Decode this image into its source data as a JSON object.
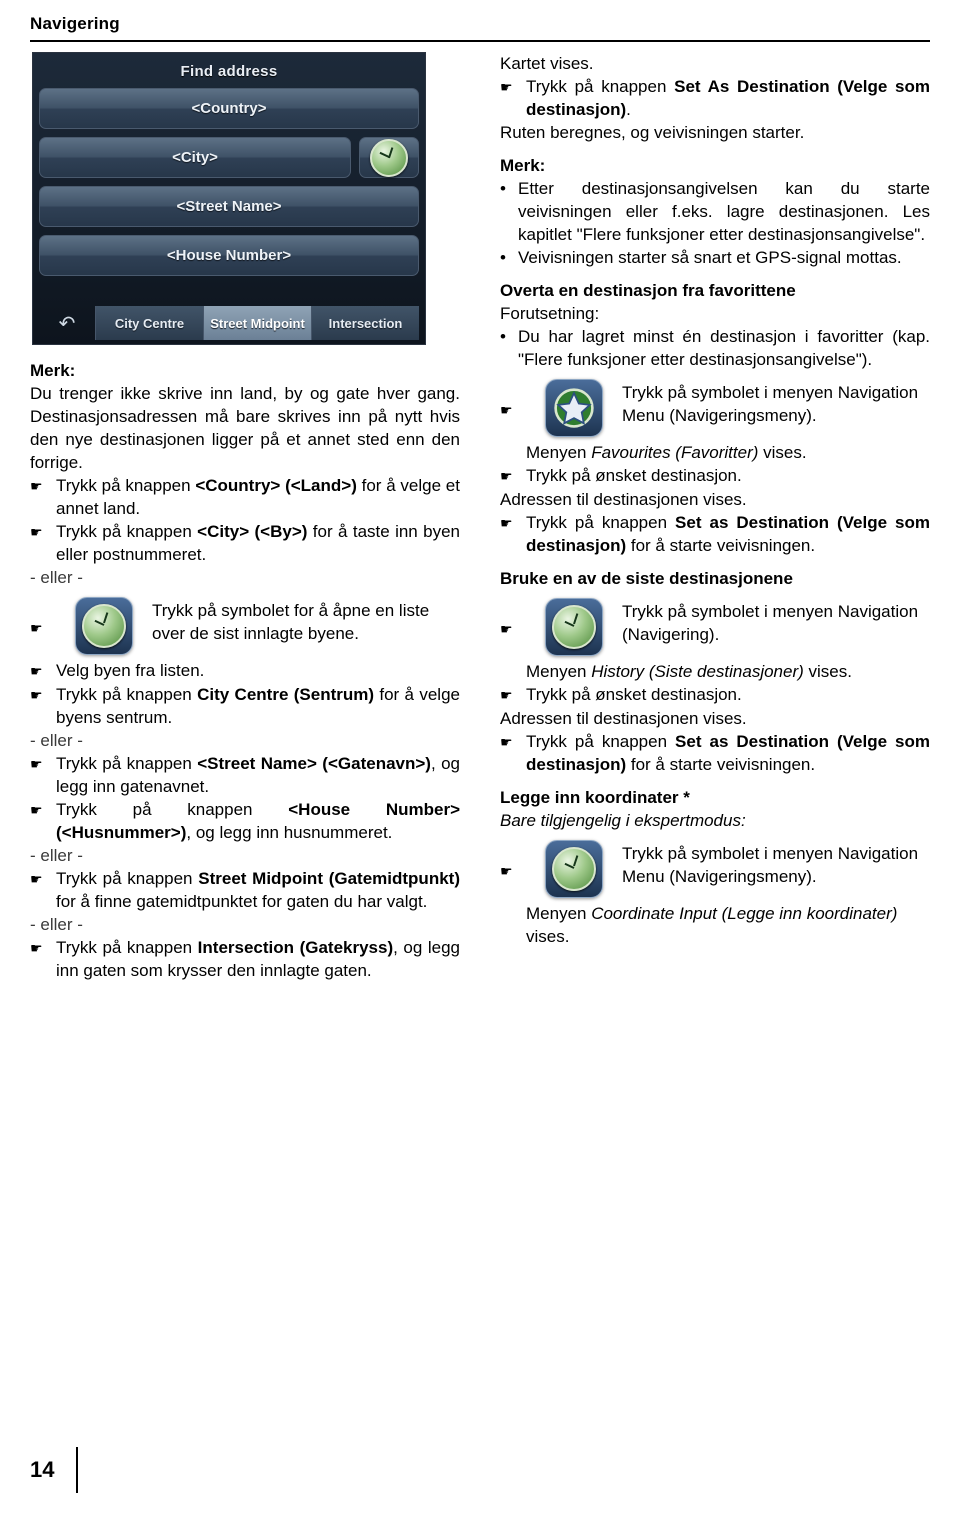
{
  "header": {
    "title": "Navigering"
  },
  "footer": {
    "page_number": "14"
  },
  "device": {
    "title": "Find address",
    "buttons": {
      "country": "<Country>",
      "city": "<City>",
      "street": "<Street Name>",
      "house": "<House Number>"
    },
    "compass_icon": "compass-icon",
    "back_icon": "back-arrow-icon",
    "tabs": [
      {
        "label": "City Centre",
        "active": false
      },
      {
        "label": "Street Midpoint",
        "active": true
      },
      {
        "label": "Intersection",
        "active": false
      }
    ]
  },
  "left": {
    "note_heading": "Merk:",
    "note_text": "Du trenger ikke skrive inn land, by og gate hver gang. Destinasjonsadressen må bare skrives inn på nytt hvis den nye destinasjonen ligger på et annet sted enn den forrige.",
    "step_country_a": "Trykk på knappen ",
    "step_country_b": "<Country> (<Land>)",
    "step_country_c": " for å velge et annet land.",
    "step_city_a": "Trykk på knappen ",
    "step_city_b": "<City> (<By>)",
    "step_city_c": " for å taste inn byen eller postnummeret.",
    "eller_1": "- eller -",
    "step_icon_city": "Trykk på symbolet for å åpne en liste over de sist innlagte byene.",
    "step_velg": "Velg byen fra listen.",
    "step_centre_a": "Trykk på knappen ",
    "step_centre_b": "City Centre (Sentrum)",
    "step_centre_c": " for å velge byens sentrum.",
    "eller_2": "- eller -",
    "step_street_a": "Trykk på knappen ",
    "step_street_b": "<Street Name> (<Gatenavn>)",
    "step_street_c": ", og legg inn gatenavnet.",
    "step_house_a": "Trykk på knappen ",
    "step_house_b": "<House Number> (<Husnummer>)",
    "step_house_c": ", og legg inn husnummeret.",
    "eller_3": "- eller -",
    "step_midpoint_a": "Trykk på knappen ",
    "step_midpoint_b": "Street Midpoint (Gatemidtpunkt)",
    "step_midpoint_c": " for å finne gatemidtpunktet for gaten du har valgt.",
    "eller_4": "- eller -",
    "step_inter_a": "Trykk på knappen ",
    "step_inter_b": "Intersection (Gatekryss)",
    "step_inter_c": ", og legg inn gaten som krysser den innlagte gaten."
  },
  "right": {
    "kartet": "Kartet vises.",
    "step_setdest_a": "Trykk på knappen ",
    "step_setdest_b": "Set As Destination (Velge som destinasjon)",
    "step_setdest_c": ".",
    "ruten": "Ruten beregnes, og veivisningen starter.",
    "merk_heading": "Merk:",
    "merk_b1": "Etter destinasjonsangivelsen kan du starte veivisningen eller f.eks. lagre destinasjonen. Les kapitlet \"Flere funksjoner etter destinasjonsangivelse\".",
    "merk_b2": "Veivisningen starter så snart et GPS-signal mottas.",
    "fav_heading": "Overta en destinasjon fra favorittene",
    "fav_forutsetning": "Forutsetning:",
    "fav_b1": "Du har lagret minst én destinasjon i favoritter (kap. \"Flere funksjoner etter destinasjonsangivelse\").",
    "fav_step_icon_a": "Trykk på symbolet i menyen Navigation Menu (Navigeringsmeny).",
    "fav_menu_a": "Menyen ",
    "fav_menu_b": "Favourites (Favoritter)",
    "fav_menu_c": " vises.",
    "fav_step_onsket": "Trykk på ønsket destinasjon.",
    "fav_adressen": "Adressen til destinasjonen vises.",
    "fav_step_setdest_a": "Trykk på knappen ",
    "fav_step_setdest_b": "Set as Destination (Velge som destinasjon)",
    "fav_step_setdest_c": " for å starte veivisningen.",
    "siste_heading": "Bruke en av de siste destinasjonene",
    "siste_step_icon_a": "Trykk på symbolet i menyen Navigation (Navigering).",
    "siste_menu_a": "Menyen ",
    "siste_menu_b": "History (Siste destinasjoner)",
    "siste_menu_c": " vises.",
    "siste_step_onsket": "Trykk på ønsket destinasjon.",
    "siste_adressen": "Adressen til destinasjonen vises.",
    "siste_step_setdest_a": "Trykk på knappen ",
    "siste_step_setdest_b": "Set as Destination (Velge som destinasjon)",
    "siste_step_setdest_c": " for å starte veivisningen.",
    "koord_heading": "Legge inn koordinater *",
    "koord_sub": "Bare tilgjengelig i ekspertmodus:",
    "koord_step_icon_a": "Trykk på symbolet i menyen Navigation Menu (Navigeringsmeny).",
    "koord_menu_a": "Menyen ",
    "koord_menu_b": "Coordinate Input (Legge inn koordinater)",
    "koord_menu_c": " vises."
  },
  "icons": {
    "hand": "☛",
    "bullet": "•",
    "compass": "compass-icon",
    "star": "star-icon"
  }
}
